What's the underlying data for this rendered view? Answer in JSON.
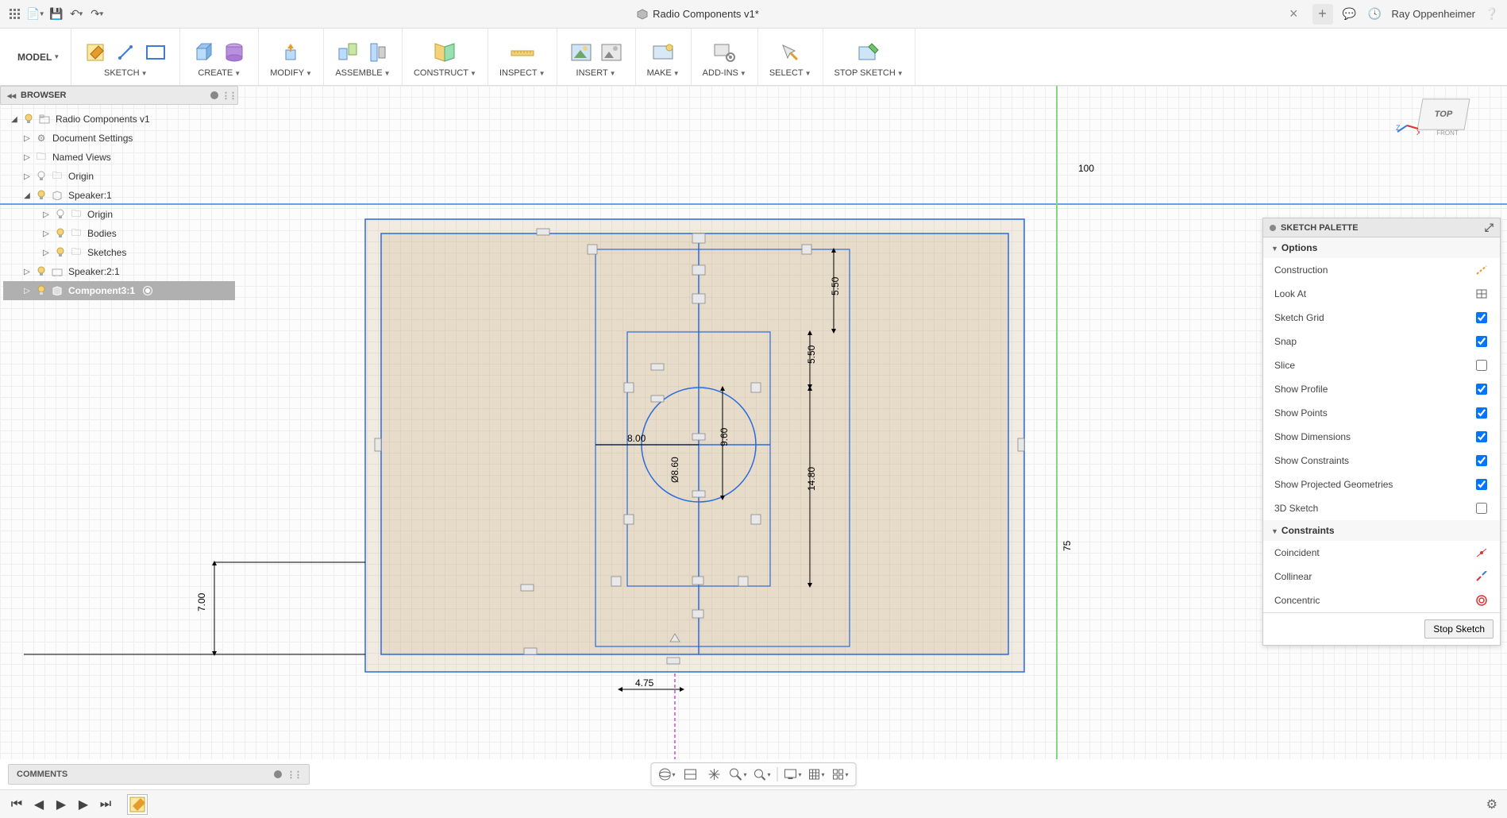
{
  "titlebar": {
    "doc_title": "Radio Components v1*",
    "user_name": "Ray Oppenheimer"
  },
  "ribbon": {
    "workspace": "MODEL",
    "sections": [
      {
        "label": "SKETCH"
      },
      {
        "label": "CREATE"
      },
      {
        "label": "MODIFY"
      },
      {
        "label": "ASSEMBLE"
      },
      {
        "label": "CONSTRUCT"
      },
      {
        "label": "INSPECT"
      },
      {
        "label": "INSERT"
      },
      {
        "label": "MAKE"
      },
      {
        "label": "ADD-INS"
      },
      {
        "label": "SELECT"
      },
      {
        "label": "STOP SKETCH"
      }
    ]
  },
  "browser": {
    "title": "BROWSER",
    "items": {
      "root": "Radio Components v1",
      "doc_settings": "Document Settings",
      "named_views": "Named Views",
      "origin": "Origin",
      "speaker1": "Speaker:1",
      "speaker1_origin": "Origin",
      "speaker1_bodies": "Bodies",
      "speaker1_sketches": "Sketches",
      "speaker2": "Speaker:2:1",
      "component3": "Component3:1"
    }
  },
  "canvas": {
    "axis_top_label": "100",
    "axis_right_label": "75",
    "dims": {
      "d1": "5.50",
      "d2": "5.50",
      "d3": "9.60",
      "d4": "Ø8.60",
      "d5": "14.80",
      "d6": "8.00",
      "d7": "4.75",
      "d8": "7.00"
    },
    "viewcube": {
      "face": "TOP",
      "front": "FRONT"
    }
  },
  "palette": {
    "title": "SKETCH PALETTE",
    "options_label": "Options",
    "constraints_label": "Constraints",
    "options": {
      "construction": "Construction",
      "look_at": "Look At",
      "sketch_grid": "Sketch Grid",
      "snap": "Snap",
      "slice": "Slice",
      "show_profile": "Show Profile",
      "show_points": "Show Points",
      "show_dimensions": "Show Dimensions",
      "show_constraints": "Show Constraints",
      "show_projected": "Show Projected Geometries",
      "sketch_3d": "3D Sketch"
    },
    "option_state": {
      "sketch_grid": true,
      "snap": true,
      "slice": false,
      "show_profile": true,
      "show_points": true,
      "show_dimensions": true,
      "show_constraints": true,
      "show_projected": true,
      "sketch_3d": false
    },
    "constraints": {
      "coincident": "Coincident",
      "collinear": "Collinear",
      "concentric": "Concentric"
    },
    "stop_btn": "Stop Sketch"
  },
  "comments": {
    "label": "COMMENTS"
  }
}
